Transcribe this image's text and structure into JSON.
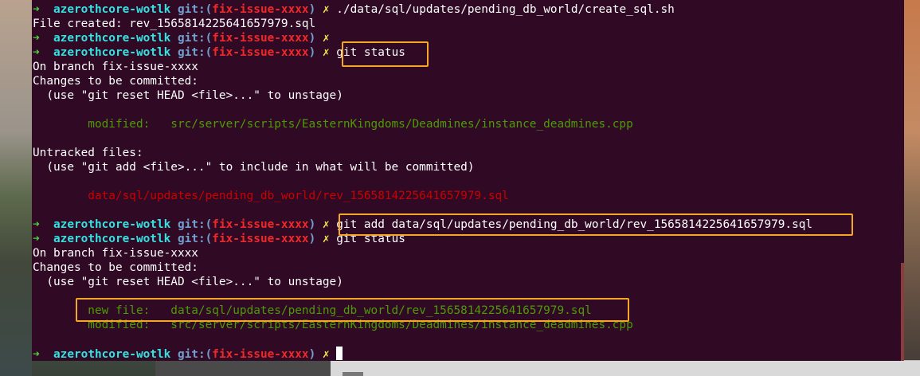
{
  "prompt": {
    "arrow": "➜",
    "dir": "azerothcore-wotlk",
    "git_label": "git:(",
    "branch": "fix-issue-xxxx",
    "close": ")",
    "dirty": "✗"
  },
  "terminal": {
    "lines": [
      {
        "kind": "prompt",
        "cmd": "./data/sql/updates/pending_db_world/create_sql.sh"
      },
      {
        "kind": "output",
        "text": "File created: rev_1565814225641657979.sql"
      },
      {
        "kind": "prompt",
        "cmd": ""
      },
      {
        "kind": "prompt",
        "cmd": "git status"
      },
      {
        "kind": "output",
        "text": "On branch fix-issue-xxxx"
      },
      {
        "kind": "output",
        "text": "Changes to be committed:"
      },
      {
        "kind": "output",
        "text": "  (use \"git reset HEAD <file>...\" to unstage)"
      },
      {
        "kind": "blank"
      },
      {
        "kind": "green",
        "text": "        modified:   src/server/scripts/EasternKingdoms/Deadmines/instance_deadmines.cpp"
      },
      {
        "kind": "blank"
      },
      {
        "kind": "output",
        "text": "Untracked files:"
      },
      {
        "kind": "output",
        "text": "  (use \"git add <file>...\" to include in what will be committed)"
      },
      {
        "kind": "blank"
      },
      {
        "kind": "red",
        "text": "        data/sql/updates/pending_db_world/rev_1565814225641657979.sql"
      },
      {
        "kind": "blank"
      },
      {
        "kind": "prompt",
        "cmd": "git add data/sql/updates/pending_db_world/rev_1565814225641657979.sql"
      },
      {
        "kind": "prompt",
        "cmd": "git status"
      },
      {
        "kind": "output",
        "text": "On branch fix-issue-xxxx"
      },
      {
        "kind": "output",
        "text": "Changes to be committed:"
      },
      {
        "kind": "output",
        "text": "  (use \"git reset HEAD <file>...\" to unstage)"
      },
      {
        "kind": "blank"
      },
      {
        "kind": "green",
        "text": "        new file:   data/sql/updates/pending_db_world/rev_1565814225641657979.sql"
      },
      {
        "kind": "green",
        "text": "        modified:   src/server/scripts/EasternKingdoms/Deadmines/instance_deadmines.cpp"
      },
      {
        "kind": "blank"
      },
      {
        "kind": "prompt",
        "cmd": "",
        "cursor": true
      }
    ]
  },
  "colors": {
    "terminal_bg": "#300a24",
    "highlight": "#f5a623"
  }
}
